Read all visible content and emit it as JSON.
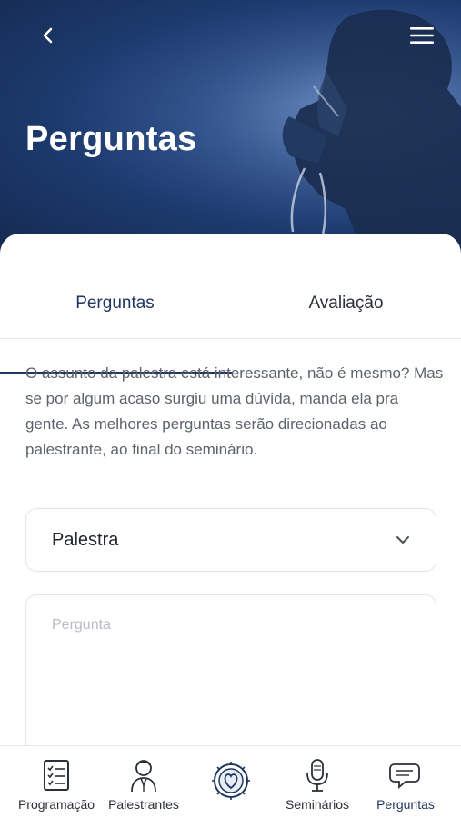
{
  "header": {
    "title": "Perguntas",
    "back_icon": "chevron-left-icon",
    "menu_icon": "hamburger-menu-icon"
  },
  "tabs": [
    {
      "label": "Perguntas",
      "active": true
    },
    {
      "label": "Avaliação",
      "active": false
    }
  ],
  "intro_text": "O assunto da palestra está interessante, não é mesmo? Mas se por algum acaso surgiu uma dúvida, manda ela pra gente. As melhores perguntas serão direcionadas ao palestrante, ao final do seminário.",
  "form": {
    "select_value": "Palestra",
    "question_placeholder": "Pergunta"
  },
  "bottom_nav": [
    {
      "label": "Programação",
      "icon": "checklist-icon",
      "active": false
    },
    {
      "label": "Palestrantes",
      "icon": "speaker-person-icon",
      "active": false
    },
    {
      "label": "",
      "icon": "logo-emblem-icon",
      "active": false
    },
    {
      "label": "Seminários",
      "icon": "microphone-icon",
      "active": false
    },
    {
      "label": "Perguntas",
      "icon": "chat-bubbles-icon",
      "active": true
    }
  ],
  "colors": {
    "accent": "#1f3760",
    "header_dark": "#14294f",
    "header_light": "#5a7fb8",
    "text_muted": "#5d636b"
  }
}
